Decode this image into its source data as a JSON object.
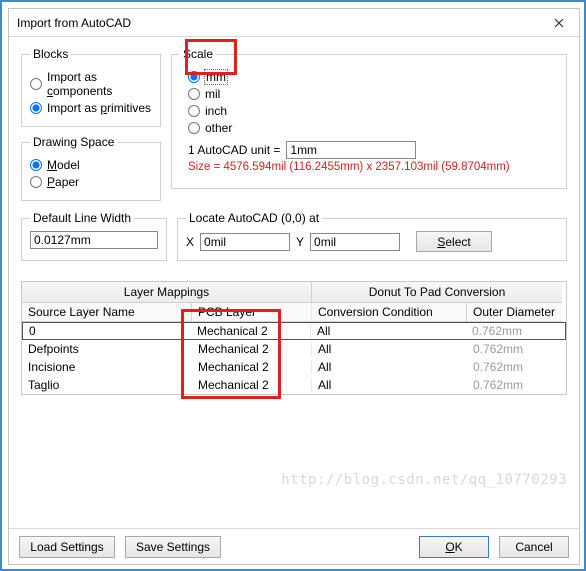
{
  "title": "Import from AutoCAD",
  "blocks": {
    "legend": "Blocks",
    "opt_components_pre": "Import as ",
    "opt_components_u": "c",
    "opt_components_post": "omponents",
    "opt_primitives_pre": "Import as ",
    "opt_primitives_u": "p",
    "opt_primitives_post": "rimitives",
    "selected": "primitives"
  },
  "drawing_space": {
    "legend": "Drawing Space",
    "opt_model_u": "M",
    "opt_model_post": "odel",
    "opt_paper_u": "P",
    "opt_paper_post": "aper",
    "selected": "model"
  },
  "scale": {
    "legend": "Scale",
    "opts": {
      "mm": "mm",
      "mil": "mil",
      "inch": "inch",
      "other": "other"
    },
    "selected": "mm",
    "unit_label": "1 AutoCAD unit  =",
    "unit_value": "1mm",
    "size_text": "Size = 4576.594mil (116.2455mm) x 2357.103mil (59.8704mm)"
  },
  "default_line_width": {
    "legend": "Default Line Width",
    "value": "0.0127mm"
  },
  "locate": {
    "legend": "Locate AutoCAD (0,0) at",
    "x_label": "X",
    "x_value": "0mil",
    "y_label": "Y",
    "y_value": "0mil",
    "select_u": "S",
    "select_post": "elect"
  },
  "grid": {
    "group_left": "Layer Mappings",
    "group_right": "Donut To Pad Conversion",
    "cols": {
      "source": "Source Layer Name",
      "pcb": "PCB Layer",
      "cond": "Conversion Condition",
      "diam": "Outer Diameter"
    },
    "rows": [
      {
        "source": "0",
        "pcb": "Mechanical 2",
        "cond": "All",
        "diam": "0.762mm"
      },
      {
        "source": "Defpoints",
        "pcb": "Mechanical 2",
        "cond": "All",
        "diam": "0.762mm"
      },
      {
        "source": "Incisione",
        "pcb": "Mechanical 2",
        "cond": "All",
        "diam": "0.762mm"
      },
      {
        "source": "Taglio",
        "pcb": "Mechanical 2",
        "cond": "All",
        "diam": "0.762mm"
      }
    ]
  },
  "footer": {
    "load": "Load Settings",
    "save": "Save Settings",
    "ok_u": "O",
    "ok_post": "K",
    "cancel": "Cancel"
  },
  "watermark": "http://blog.csdn.net/qq_10770293"
}
